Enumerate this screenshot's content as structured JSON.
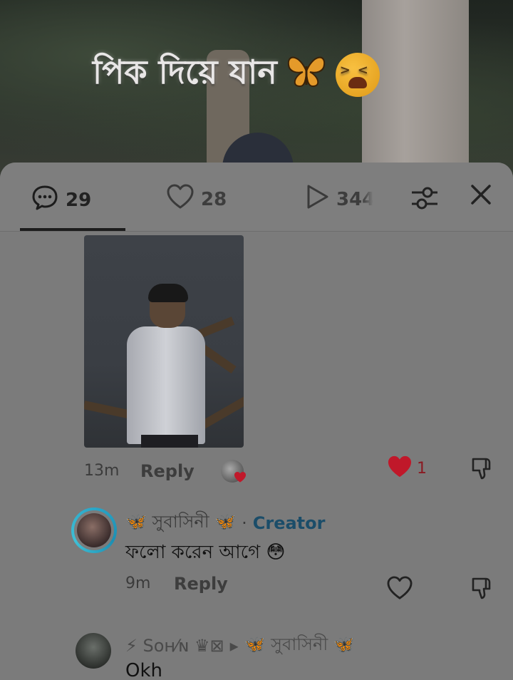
{
  "video": {
    "overlay_text": "পিক দিয়ে যান",
    "overlay_emojis": [
      "butterfly-emoji",
      "tired-face-emoji"
    ]
  },
  "header": {
    "comments_count": "29",
    "likes_count": "28",
    "views_count": "344",
    "icons": [
      "comment-icon",
      "heart-icon",
      "play-icon",
      "filter-icon",
      "close-icon"
    ]
  },
  "comments": [
    {
      "type": "photo",
      "time": "13m",
      "reply_label": "Reply",
      "like_count": "1",
      "liked": true,
      "creator_liked": true
    },
    {
      "author": "🦋 সুবাসিনী 🦋",
      "separator": "·",
      "badge": "Creator",
      "text": "ফলো করেন আগে 😳",
      "time": "9m",
      "reply_label": "Reply",
      "liked": false
    },
    {
      "author": "⚡ Sᴏʜ⁄ɴ ♛⊠",
      "reply_arrow": "▸",
      "reply_to": "🦋 সুবাসিনী 🦋",
      "text": "Okh"
    }
  ],
  "colors": {
    "sheet_bg": "#7b7b7b",
    "creator_badge": "#1b4d69",
    "liked_heart": "#c0182a"
  }
}
